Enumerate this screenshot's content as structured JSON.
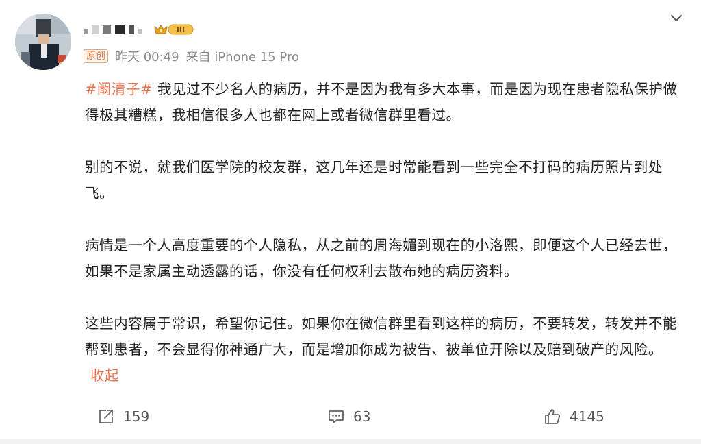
{
  "post": {
    "author": {
      "name_obscured": true,
      "level_badge": "Ⅲ",
      "level_badge_color": "#f5c04a"
    },
    "meta": {
      "tag": "原创",
      "time": "昨天 00:49",
      "source": "来自 iPhone 15 Pro"
    },
    "content": {
      "hashtag": "#阚清子#",
      "paragraph_1": " 我见过不少名人的病历，并不是因为我有多大本事，而是因为现在患者隐私保护做得极其糟糕，我相信很多人也都在网上或者微信群里看过。",
      "paragraph_2": "别的不说，就我们医学院的校友群，这几年还是时常能看到一些完全不打码的病历照片到处飞。",
      "paragraph_3": "病情是一个人高度重要的个人隐私，从之前的周海媚到现在的小洛熙，即便这个人已经去世，如果不是家属主动透露的话，你没有任何权利去散布她的病历资料。",
      "paragraph_4": "这些内容属于常识，希望你记住。如果你在微信群里看到这样的病历，不要转发，转发并不能帮到患者，不会显得你神通广大，而是增加你成为被告、被单位开除以及赔到破产的风险。",
      "collapse_label": "收起"
    },
    "actions": {
      "repost_count": "159",
      "comment_count": "63",
      "like_count": "4145"
    },
    "colors": {
      "accent": "#eb7350",
      "text": "#222222",
      "meta": "#8a8a8a"
    },
    "icons": [
      "chevron-down-icon",
      "repost-icon",
      "comment-icon",
      "like-icon"
    ]
  }
}
